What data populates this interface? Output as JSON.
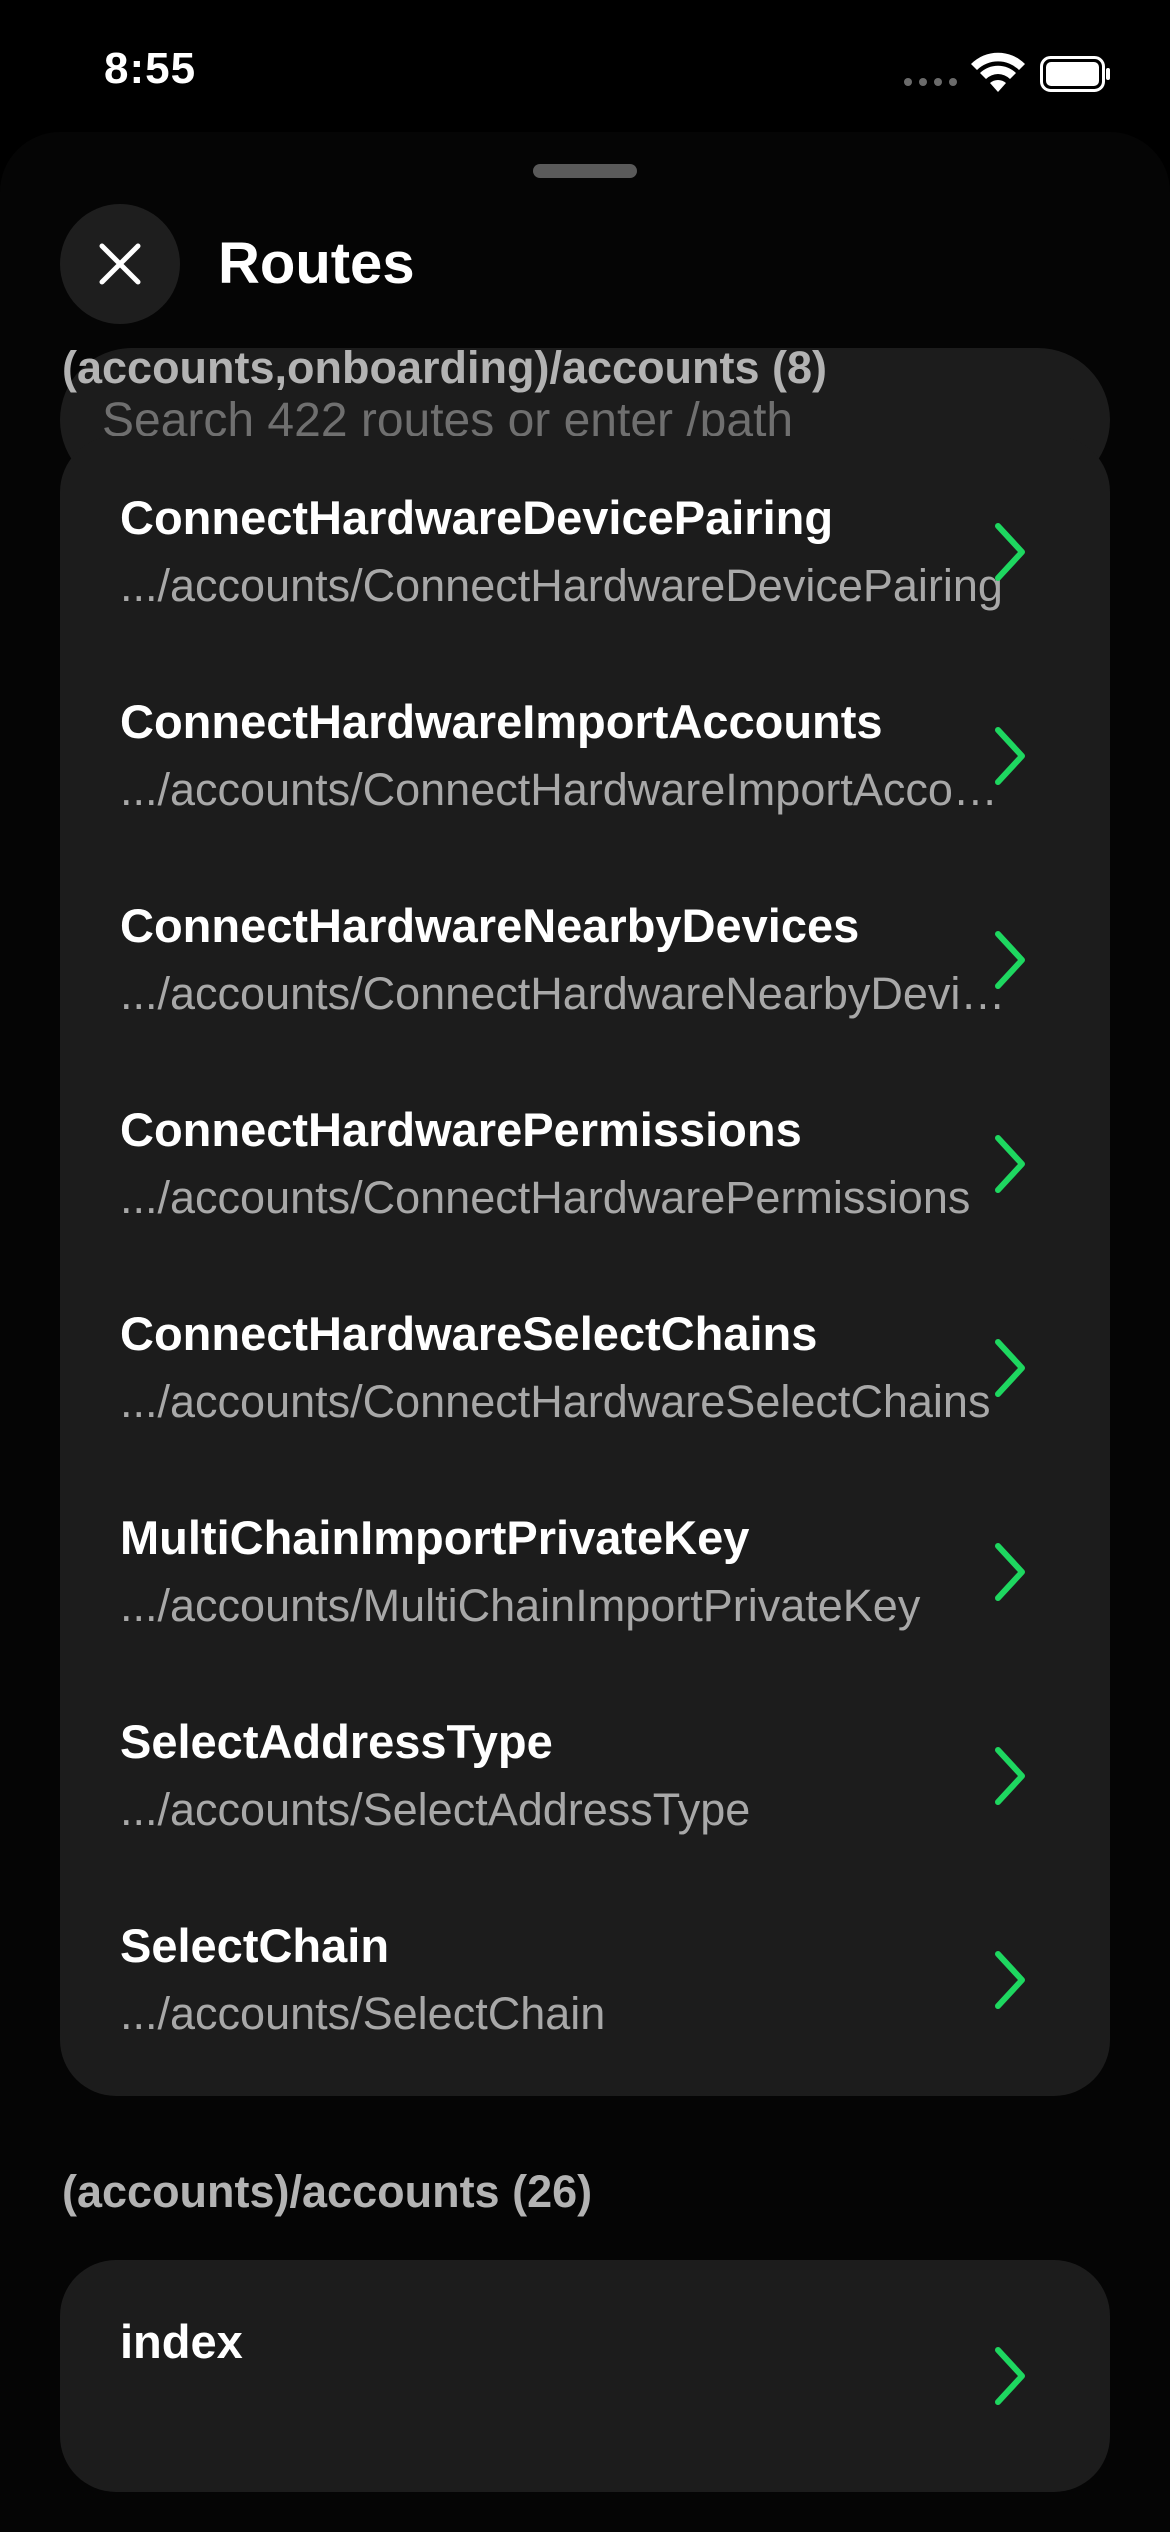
{
  "status_bar": {
    "time": "8:55"
  },
  "header": {
    "title": "Routes"
  },
  "search": {
    "placeholder": "Search 422 routes or enter /path"
  },
  "colors": {
    "accent": "#1ed760",
    "card": "#1c1c1c",
    "background": "#050505"
  },
  "sections": [
    {
      "title": "(accounts,onboarding)/accounts (8)",
      "items": [
        {
          "name": "ConnectHardwareDevicePairing",
          "path": ".../accounts/ConnectHardwareDevicePairing"
        },
        {
          "name": "ConnectHardwareImportAccounts",
          "path": ".../accounts/ConnectHardwareImportAccounts"
        },
        {
          "name": "ConnectHardwareNearbyDevices",
          "path": ".../accounts/ConnectHardwareNearbyDevices"
        },
        {
          "name": "ConnectHardwarePermissions",
          "path": ".../accounts/ConnectHardwarePermissions"
        },
        {
          "name": "ConnectHardwareSelectChains",
          "path": ".../accounts/ConnectHardwareSelectChains"
        },
        {
          "name": "MultiChainImportPrivateKey",
          "path": ".../accounts/MultiChainImportPrivateKey"
        },
        {
          "name": "SelectAddressType",
          "path": ".../accounts/SelectAddressType"
        },
        {
          "name": "SelectChain",
          "path": ".../accounts/SelectChain"
        }
      ]
    },
    {
      "title": "(accounts)/accounts (26)",
      "items": [
        {
          "name": "index"
        }
      ]
    }
  ]
}
